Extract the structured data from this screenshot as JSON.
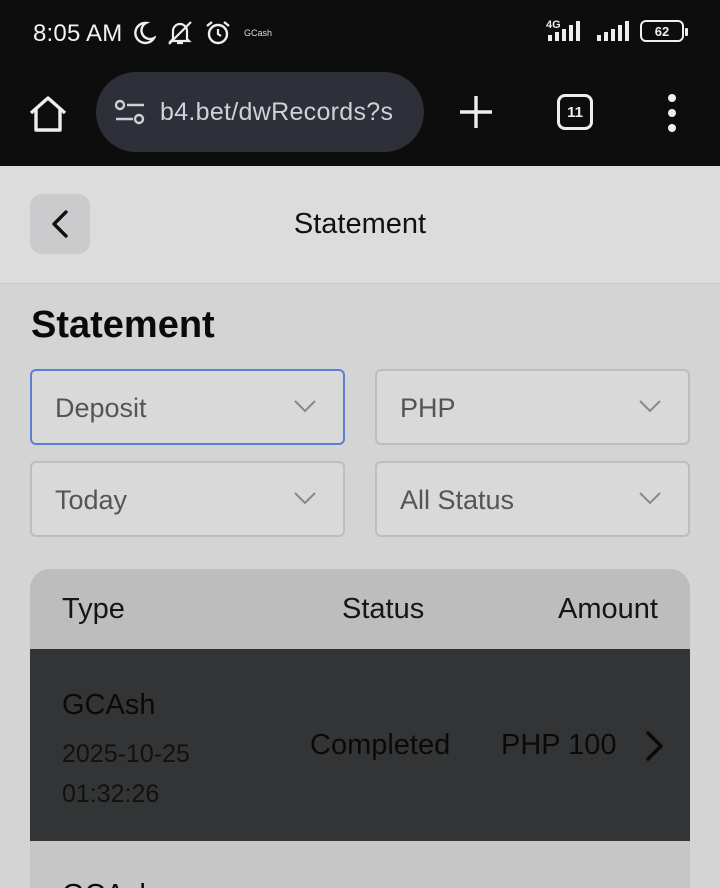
{
  "status_bar": {
    "time": "8:05 AM",
    "network": "4G",
    "battery": "62",
    "notification_label": "GCash",
    "icons": [
      "moon-icon",
      "bell-off-icon",
      "alarm-icon",
      "signal-icon",
      "battery-icon"
    ]
  },
  "browser": {
    "url": "b4.bet/dwRecords?s",
    "tab_count": "11",
    "icons": [
      "home-icon",
      "site-settings-icon",
      "plus-icon",
      "tabs-icon",
      "more-vert-icon"
    ]
  },
  "header": {
    "title": "Statement",
    "back_icon": "chevron-left-icon"
  },
  "page": {
    "section_title": "Statement"
  },
  "filters": {
    "type": "Deposit",
    "currency": "PHP",
    "date_range": "Today",
    "status": "All Status"
  },
  "table": {
    "columns": [
      "Type",
      "Status",
      "Amount"
    ],
    "rows": [
      {
        "type": "GCAsh",
        "date": "2025-10-25",
        "time": "01:32:26",
        "status": "Completed",
        "amount": "PHP 100"
      },
      {
        "type": "GCAsh"
      }
    ]
  },
  "colors": {
    "status_bar_bg": "#0d0d0d",
    "url_bar_bg": "#2e3039",
    "active_select_border": "#5c7fd4",
    "highlighted_row_bg": "#333435"
  }
}
